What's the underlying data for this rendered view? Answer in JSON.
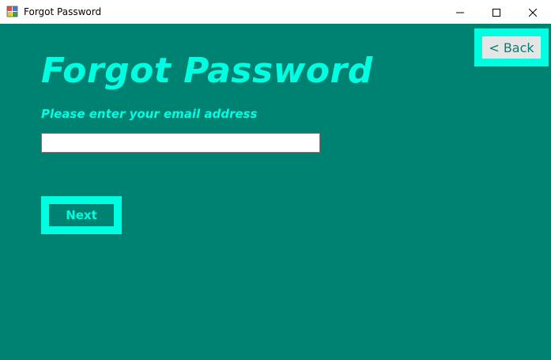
{
  "window": {
    "title": "Forgot Password",
    "icon": "winforms-app-icon"
  },
  "controls": {
    "minimize": "minimize-icon",
    "maximize": "maximize-icon",
    "close": "close-icon"
  },
  "form": {
    "heading": "Forgot Password",
    "prompt": "Please enter your email address",
    "email_value": "",
    "next_label": "Next",
    "back_label": "< Back"
  },
  "colors": {
    "background": "#008272",
    "accent": "#00ffe1",
    "back_button_face": "#e5e5e5",
    "input_background": "#ffffff"
  }
}
